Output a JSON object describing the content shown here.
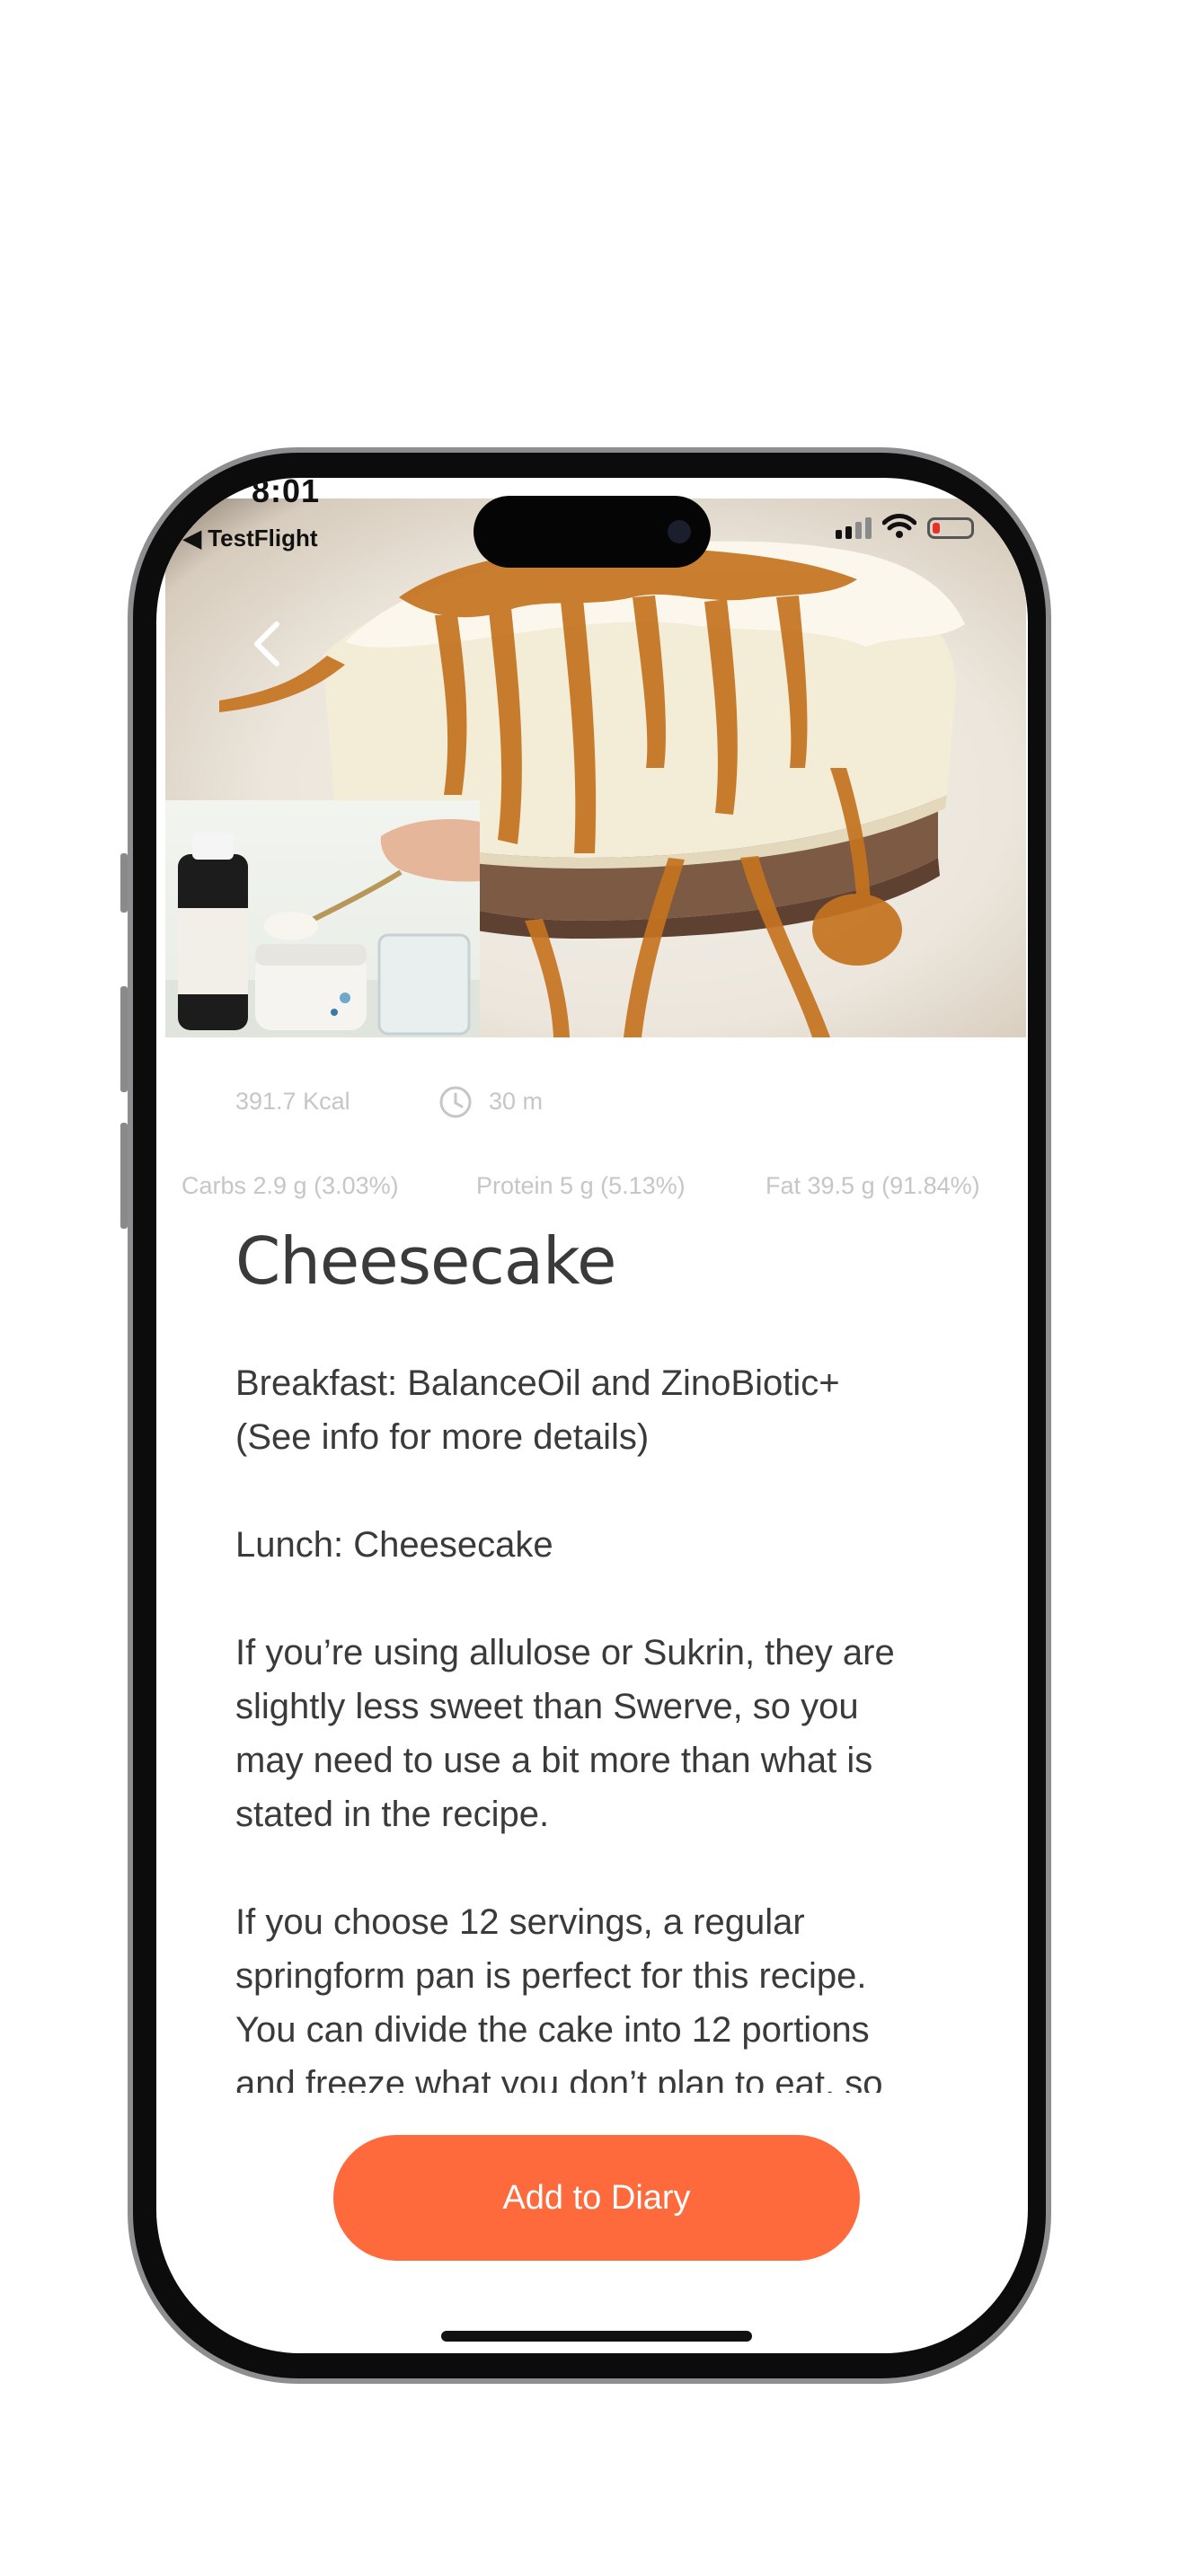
{
  "status_bar": {
    "time": "8:01",
    "back_app": "◀ TestFlight"
  },
  "icons": {
    "back": "chevron-left-icon",
    "clock": "clock-icon",
    "signal": "cellular-signal-icon",
    "wifi": "wifi-icon",
    "battery": "battery-low-icon"
  },
  "recipe": {
    "calories": "391.7 Kcal",
    "time": "30 m",
    "macros": {
      "carbs": "Carbs 2.9 g (3.03%)",
      "protein": "Protein 5 g (5.13%)",
      "fat": "Fat 39.5 g (91.84%)"
    },
    "title": "Cheesecake",
    "paragraphs": [
      "Breakfast: BalanceOil and ZinoBiotic+\n(See info for more details)",
      "Lunch: Cheesecake",
      "If you’re using allulose or Sukrin, they are\nslightly less sweet than Swerve, so you\nmay need to use a bit more than what is\nstated in the recipe.",
      "If you choose 12 servings, a regular\nspringform pan is perfect for this recipe.\nYou can divide the cake into 12 portions\nand freeze what you don’t plan to eat, so"
    ]
  },
  "actions": {
    "add_to_diary": "Add to Diary"
  },
  "colors": {
    "accent": "#ff6a3d",
    "stat_text": "#c6c6c6",
    "body_text": "#3a3a3a"
  }
}
